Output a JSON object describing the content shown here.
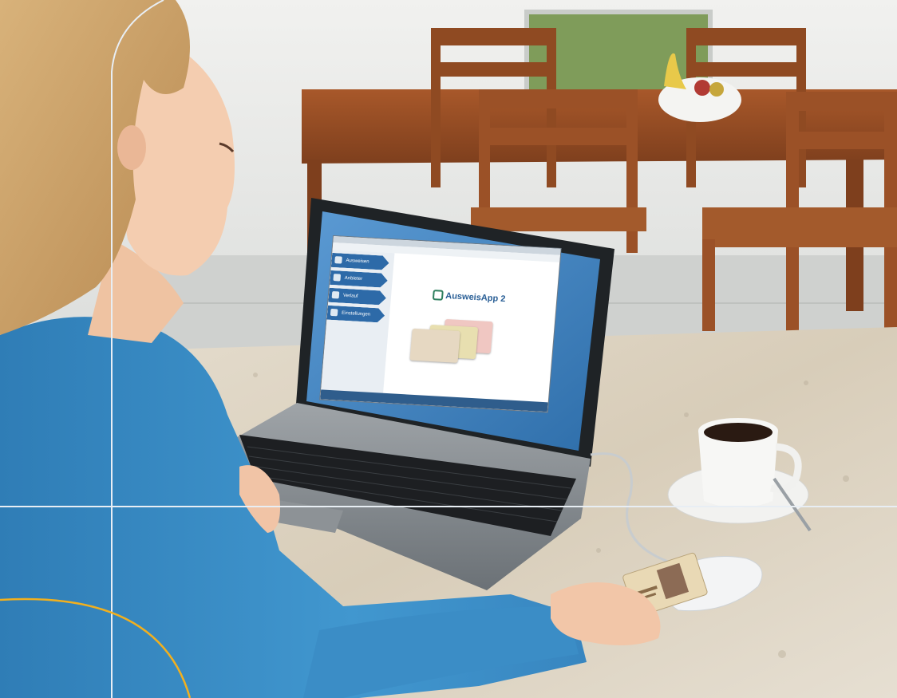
{
  "scene": {
    "description_free": true
  },
  "laptop_screen": {
    "menu": [
      "",
      "",
      ""
    ],
    "nav": {
      "items": [
        {
          "label": "Ausweisen"
        },
        {
          "label": "Anbieter"
        },
        {
          "label": "Verlauf"
        },
        {
          "label": "Einstellungen"
        }
      ]
    },
    "logo_text": "AusweisApp 2"
  },
  "colors": {
    "nav_blue": "#2d6aa8",
    "screen_bg": "#4d8cc4",
    "sweater": "#3f8ec4",
    "accent_line": "#f2b01e"
  }
}
